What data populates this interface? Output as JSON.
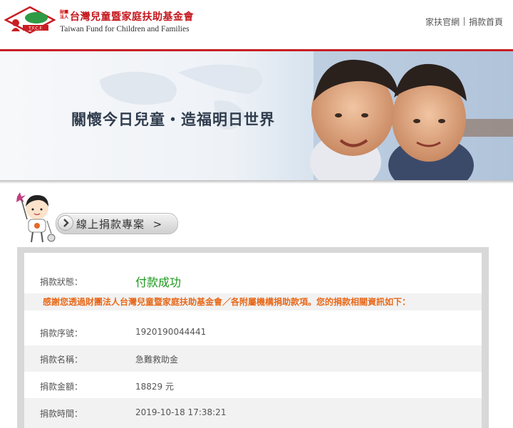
{
  "header": {
    "org_prefix": [
      "財團",
      "法人"
    ],
    "org_name_zh": "台灣兒童暨家庭扶助基金會",
    "org_name_en": "Taiwan Fund for Children and Families",
    "logo_text": "T.F.C.F.",
    "links": [
      {
        "label": "家扶官網"
      },
      {
        "label": "捐款首頁"
      }
    ]
  },
  "banner": {
    "slogan": "關懷今日兒童・造福明日世界"
  },
  "section": {
    "title": "線上捐款專案",
    "arrow": ">"
  },
  "donation": {
    "status_label": "捐款狀態：",
    "status_value": "付款成功",
    "notice": "感謝您透過財團法人台灣兒童暨家庭扶助基金會／各附屬機構捐助款項。您的捐款相關資訊如下：",
    "rows": [
      {
        "label": "捐款序號：",
        "value": "1920190044441"
      },
      {
        "label": "捐款名稱：",
        "value": "急難救助金"
      },
      {
        "label": "捐款金額：",
        "value": "18829 元"
      },
      {
        "label": "捐款時間：",
        "value": "2019-10-18 17:38:21"
      }
    ]
  },
  "colors": {
    "brand_red": "#c81e24",
    "success_green": "#1a9a1a",
    "notice_orange": "#e8691a"
  }
}
